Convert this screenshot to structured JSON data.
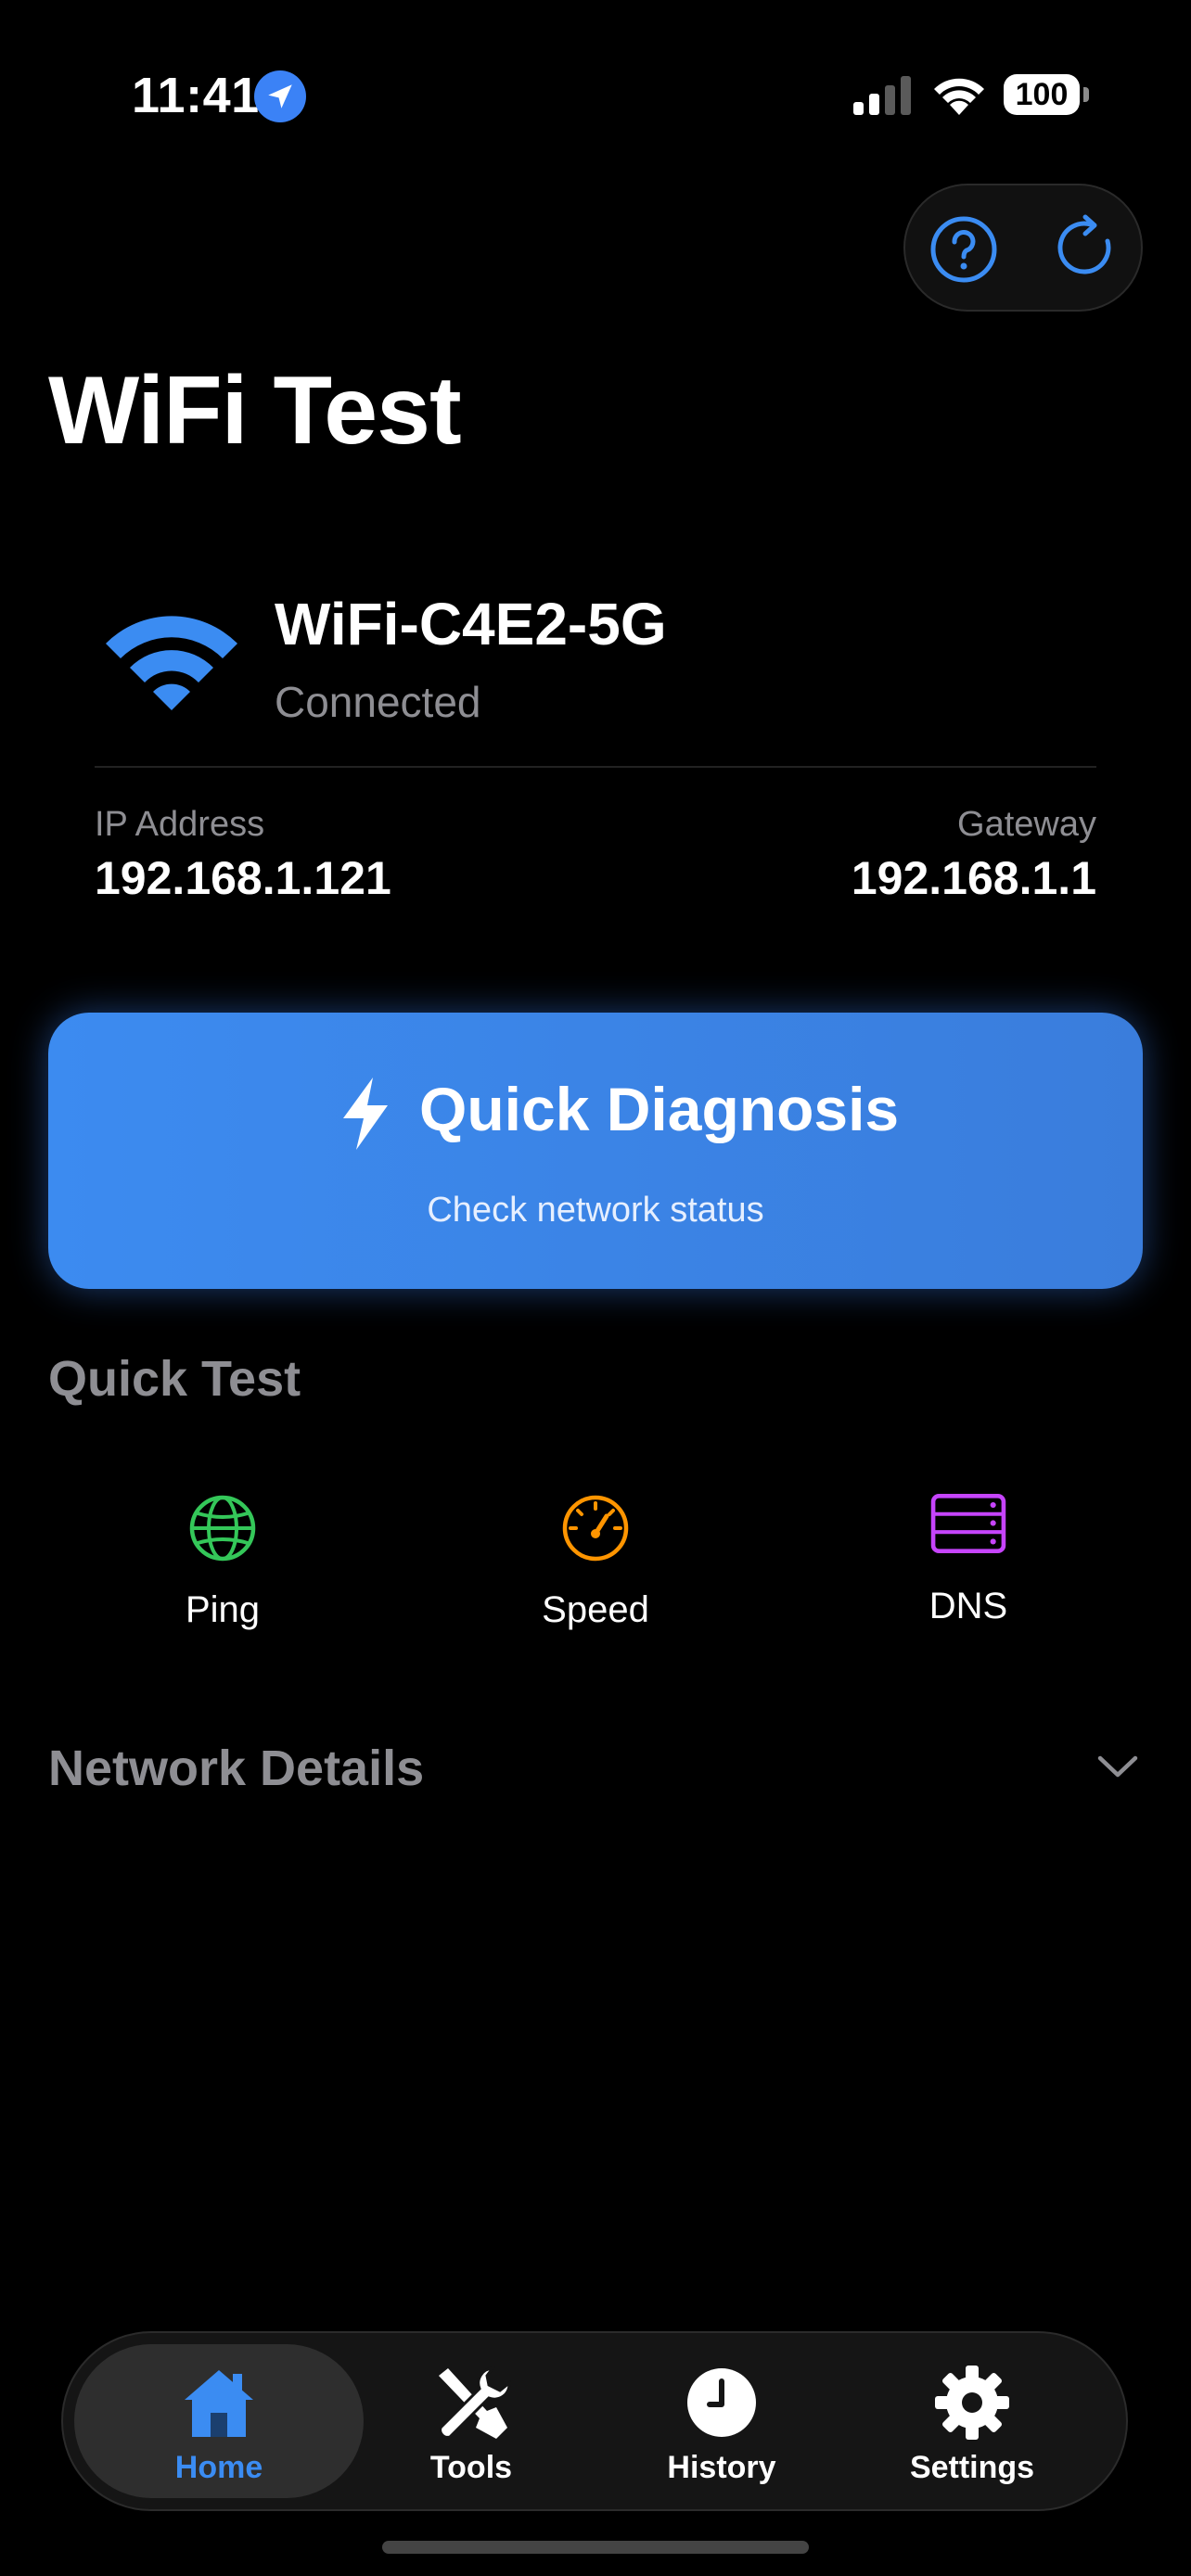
{
  "status_bar": {
    "time": "11:41",
    "battery": "100",
    "icons": [
      "location-arrow-icon",
      "cellular-signal-icon",
      "wifi-icon"
    ]
  },
  "top_actions": {
    "help_icon": "question-circle-icon",
    "refresh_icon": "refresh-icon",
    "accent_color": "#3b8cf2"
  },
  "page": {
    "title": "WiFi Test"
  },
  "network": {
    "name": "WiFi-C4E2-5G",
    "status": "Connected",
    "ip_label": "IP Address",
    "ip_value": "192.168.1.121",
    "gateway_label": "Gateway",
    "gateway_value": "192.168.1.1",
    "icon": "wifi-icon",
    "icon_color": "#3b8cf2"
  },
  "quick_diagnosis": {
    "title": "Quick Diagnosis",
    "subtitle": "Check network status",
    "icon": "lightning-bolt-icon"
  },
  "quick_test": {
    "title": "Quick Test",
    "items": [
      {
        "label": "Ping",
        "icon": "globe-icon",
        "color": "#34c759"
      },
      {
        "label": "Speed",
        "icon": "speedometer-icon",
        "color": "#ff9500"
      },
      {
        "label": "DNS",
        "icon": "server-icon",
        "color": "#c644fc"
      }
    ]
  },
  "network_details": {
    "title": "Network Details",
    "icon": "chevron-down-icon"
  },
  "tab_bar": {
    "active": "Home",
    "tabs": [
      {
        "label": "Home",
        "icon": "house-icon"
      },
      {
        "label": "Tools",
        "icon": "tools-icon"
      },
      {
        "label": "History",
        "icon": "clock-icon"
      },
      {
        "label": "Settings",
        "icon": "gear-icon"
      }
    ]
  }
}
